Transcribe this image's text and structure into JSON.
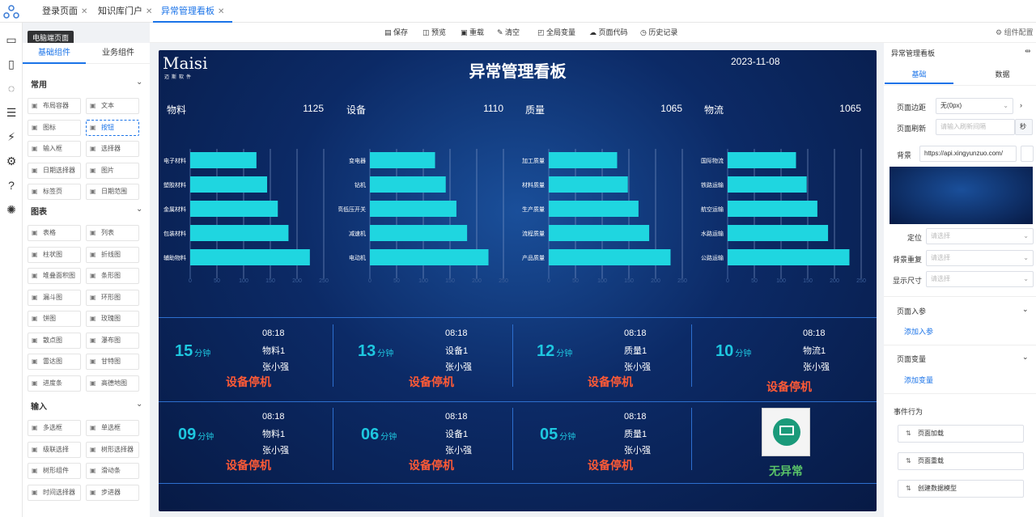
{
  "tabs": [
    {
      "label": "登录页面"
    },
    {
      "label": "知识库门户"
    },
    {
      "label": "异常管理看板"
    }
  ],
  "tooltip": "电脑端页面",
  "left": {
    "tabs": [
      "基础组件",
      "业务组件"
    ],
    "sections": [
      {
        "title": "常用",
        "items": [
          [
            "layout-icon",
            "布局容器"
          ],
          [
            "text-icon",
            "文本"
          ],
          [
            "image-icon",
            "图标"
          ],
          [
            "button-icon",
            "按钮"
          ],
          [
            "input-icon",
            "输入框"
          ],
          [
            "select-icon",
            "选择器"
          ],
          [
            "date-icon",
            "日期选择器"
          ],
          [
            "picture-icon",
            "图片"
          ],
          [
            "tabs-icon",
            "标签页"
          ],
          [
            "daterange-icon",
            "日期范围"
          ]
        ]
      },
      {
        "title": "图表",
        "items": [
          [
            "table-icon",
            "表格"
          ],
          [
            "list-icon",
            "列表"
          ],
          [
            "bar-chart-icon",
            "柱状图"
          ],
          [
            "line-chart-icon",
            "折线图"
          ],
          [
            "area-chart-icon",
            "堆叠面积图"
          ],
          [
            "hbar-chart-icon",
            "条形图"
          ],
          [
            "funnel-icon",
            "漏斗图"
          ],
          [
            "ring-icon",
            "环形图"
          ],
          [
            "pie-icon",
            "饼图"
          ],
          [
            "rose-icon",
            "玫瑰图"
          ],
          [
            "scatter-icon",
            "散点图"
          ],
          [
            "waterfall-icon",
            "瀑布图"
          ],
          [
            "radar-icon",
            "雷达图"
          ],
          [
            "gantt-icon",
            "甘特图"
          ],
          [
            "progress-icon",
            "进度条"
          ],
          [
            "heatmap-icon",
            "高德地图"
          ]
        ]
      },
      {
        "title": "输入",
        "items": [
          [
            "checkbox-icon",
            "多选框"
          ],
          [
            "radio-icon",
            "单选框"
          ],
          [
            "cascader-icon",
            "级联选择"
          ],
          [
            "tree-select-icon",
            "树形选择器"
          ],
          [
            "tree-icon",
            "树形组件"
          ],
          [
            "slider-icon",
            "滑动条"
          ],
          [
            "time-icon",
            "时间选择器"
          ],
          [
            "stepper-icon",
            "步进器"
          ]
        ]
      }
    ]
  },
  "toolbar": [
    "保存",
    "预览",
    "重载",
    "清空",
    "全局变量",
    "页面代码",
    "历史记录"
  ],
  "toolbar_right": "组件配置",
  "screen": {
    "logo": "Maisi",
    "logo_sub": "迈斯软件",
    "title": "异常管理看板",
    "date": "2023-11-08"
  },
  "chart_data": [
    {
      "type": "bar",
      "title": "物料",
      "total": "1125",
      "categories": [
        "电子材料",
        "塑胶材料",
        "金属材料",
        "包装材料",
        "辅助物料"
      ],
      "values": [
        124,
        144,
        164,
        184,
        224
      ],
      "xlim": [
        0,
        250
      ],
      "ticks": [
        "0",
        "50",
        "100",
        "150",
        "200",
        "250"
      ]
    },
    {
      "type": "bar",
      "title": "设备",
      "total": "1110",
      "categories": [
        "变电器",
        "钻机",
        "高低压开关",
        "减速机",
        "电动机"
      ],
      "values": [
        122,
        142,
        162,
        182,
        222
      ],
      "xlim": [
        0,
        250
      ],
      "ticks": [
        "0",
        "50",
        "100",
        "150",
        "200",
        "250"
      ]
    },
    {
      "type": "bar",
      "title": "质量",
      "total": "1065",
      "categories": [
        "加工质量",
        "材料质量",
        "生产质量",
        "流程质量",
        "产品质量"
      ],
      "values": [
        128,
        148,
        168,
        188,
        228
      ],
      "xlim": [
        0,
        250
      ],
      "ticks": [
        "0",
        "50",
        "100",
        "150",
        "200",
        "250"
      ]
    },
    {
      "type": "bar",
      "title": "物流",
      "total": "1065",
      "categories": [
        "国际物流",
        "铁路运输",
        "航空运输",
        "水路运输",
        "公路运输"
      ],
      "values": [
        128,
        148,
        168,
        188,
        228
      ],
      "xlim": [
        0,
        250
      ],
      "ticks": [
        "0",
        "50",
        "100",
        "150",
        "200",
        "250"
      ]
    }
  ],
  "cards": [
    {
      "min": "15",
      "unit": "分钟",
      "time": "08:18",
      "obj": "物料1",
      "user": "张小强",
      "status": "设备停机"
    },
    {
      "min": "13",
      "unit": "分钟",
      "time": "08:18",
      "obj": "设备1",
      "user": "张小强",
      "status": "设备停机"
    },
    {
      "min": "12",
      "unit": "分钟",
      "time": "08:18",
      "obj": "质量1",
      "user": "张小强",
      "status": "设备停机"
    },
    {
      "min": "10",
      "unit": "分钟",
      "time": "08:18",
      "obj": "物流1",
      "user": "张小强",
      "status": "设备停机"
    },
    {
      "min": "09",
      "unit": "分钟",
      "time": "08:18",
      "obj": "物料1",
      "user": "张小强",
      "status": "设备停机"
    },
    {
      "min": "06",
      "unit": "分钟",
      "time": "08:18",
      "obj": "设备1",
      "user": "张小强",
      "status": "设备停机"
    },
    {
      "min": "05",
      "unit": "分钟",
      "time": "08:18",
      "obj": "质量1",
      "user": "张小强",
      "status": "设备停机"
    }
  ],
  "ok_text": "无异常",
  "right": {
    "head": "异常管理看板",
    "tabs": [
      "基础",
      "数据"
    ],
    "margin_label": "页面边距",
    "margin_value": "无(0px)",
    "refresh_label": "页面刷新",
    "refresh_placeholder": "请输入刷新间隔",
    "refresh_unit": "秒",
    "bg_label": "背景",
    "bg_value": "https://api.xingyunzuo.com/",
    "pos_label": "定位",
    "pos_placeholder": "请选择",
    "repeat_label": "背景重复",
    "repeat_placeholder": "请选择",
    "size_label": "显示尺寸",
    "size_placeholder": "请选择",
    "params_label": "页面入参",
    "add_param": "添加入参",
    "vars_label": "页面变量",
    "add_var": "添加变量",
    "events_label": "事件行为",
    "events": [
      "页面加载",
      "页面重载",
      "创建数据模型"
    ]
  }
}
